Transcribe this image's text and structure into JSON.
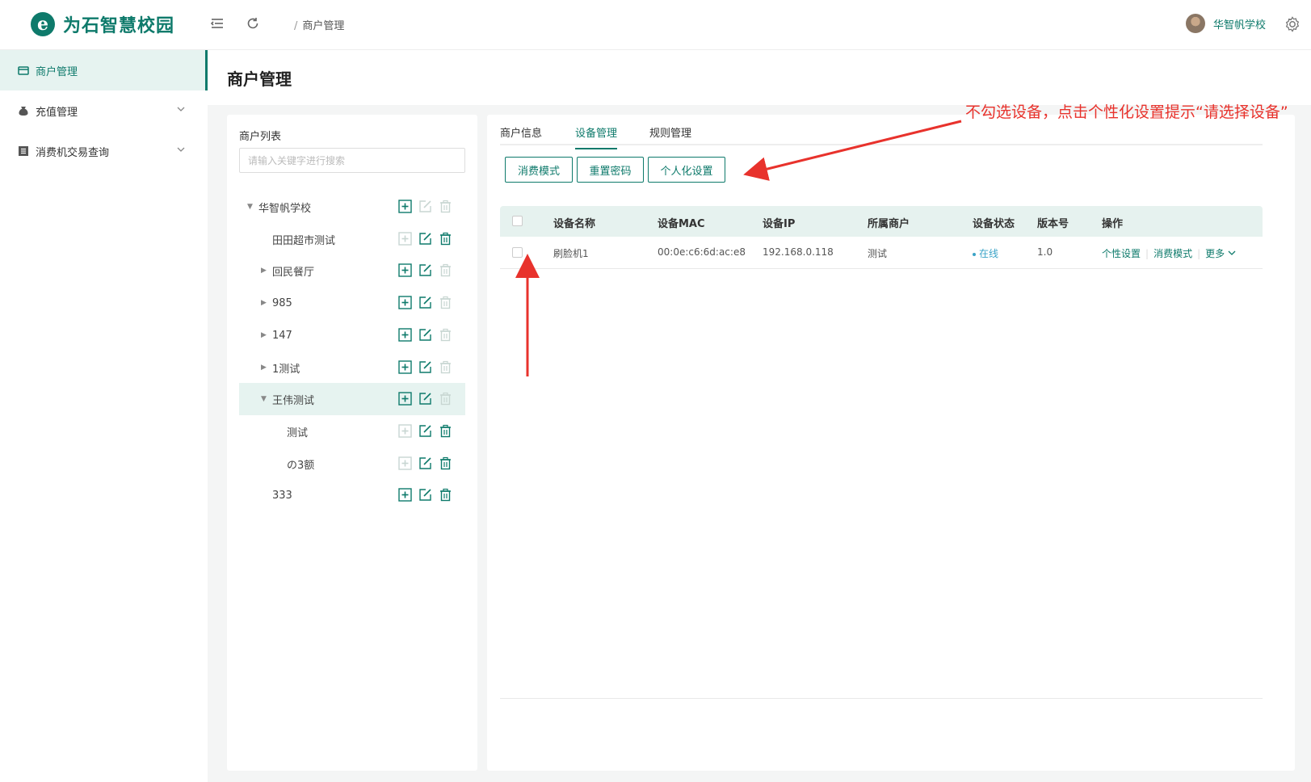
{
  "app": {
    "logo_letter": "e",
    "title": "为石智慧校园",
    "brand_color": "#0e7a6b"
  },
  "header": {
    "breadcrumb_sep": "/",
    "breadcrumb": "商户管理",
    "user_name": "华智帆学校",
    "icons": [
      "menu-fold-icon",
      "refresh-icon",
      "settings-icon"
    ]
  },
  "sidebar": {
    "items": [
      {
        "label": "商户管理",
        "icon": "shop-icon",
        "active": true
      },
      {
        "label": "充值管理",
        "icon": "money-bag-icon",
        "expandable": true
      },
      {
        "label": "消费机交易查询",
        "icon": "list-icon",
        "expandable": true
      }
    ]
  },
  "page": {
    "title": "商户管理"
  },
  "merchant_list": {
    "title": "商户列表",
    "search_placeholder": "请输入关键字进行搜索",
    "tree": [
      {
        "label": "华智帆学校",
        "level": 0,
        "caret": "down",
        "add": true,
        "edit": false,
        "del": false
      },
      {
        "label": "田田超市测试",
        "level": 1,
        "caret": "",
        "add": false,
        "edit": true,
        "del": true
      },
      {
        "label": "回民餐厅",
        "level": 1,
        "caret": "right",
        "add": true,
        "edit": true,
        "del": false
      },
      {
        "label": "985",
        "level": 1,
        "caret": "right",
        "add": true,
        "edit": true,
        "del": false
      },
      {
        "label": "147",
        "level": 1,
        "caret": "right",
        "add": true,
        "edit": true,
        "del": false
      },
      {
        "label": "1测试",
        "level": 1,
        "caret": "right",
        "add": true,
        "edit": true,
        "del": false
      },
      {
        "label": "王伟测试",
        "level": 1,
        "caret": "down",
        "add": true,
        "edit": true,
        "del": false,
        "selected": true
      },
      {
        "label": "测试",
        "level": 2,
        "caret": "",
        "add": false,
        "edit": true,
        "del": true
      },
      {
        "label": "の3额",
        "level": 2,
        "caret": "",
        "add": false,
        "edit": true,
        "del": true
      },
      {
        "label": "333",
        "level": 1,
        "caret": "",
        "add": true,
        "edit": true,
        "del": true
      }
    ]
  },
  "tabs": [
    {
      "label": "商户信息",
      "active": false
    },
    {
      "label": "设备管理",
      "active": true
    },
    {
      "label": "规则管理",
      "active": false
    }
  ],
  "toolbar": {
    "consume_mode": "消费模式",
    "reset_password": "重置密码",
    "personal_settings": "个人化设置"
  },
  "device_table": {
    "columns": [
      "设备名称",
      "设备MAC",
      "设备IP",
      "所属商户",
      "设备状态",
      "版本号",
      "操作"
    ],
    "rows": [
      {
        "name": "刷脸机1",
        "mac": "00:0e:c6:6d:ac:e8",
        "ip": "192.168.0.118",
        "merchant": "测试",
        "status": "在线",
        "version": "1.0",
        "actions": [
          "个性设置",
          "消费模式",
          "更多"
        ]
      }
    ]
  },
  "annotation": {
    "text": "不勾选设备，点击个性化设置提示“请选择设备”",
    "color": "#e8322c"
  }
}
